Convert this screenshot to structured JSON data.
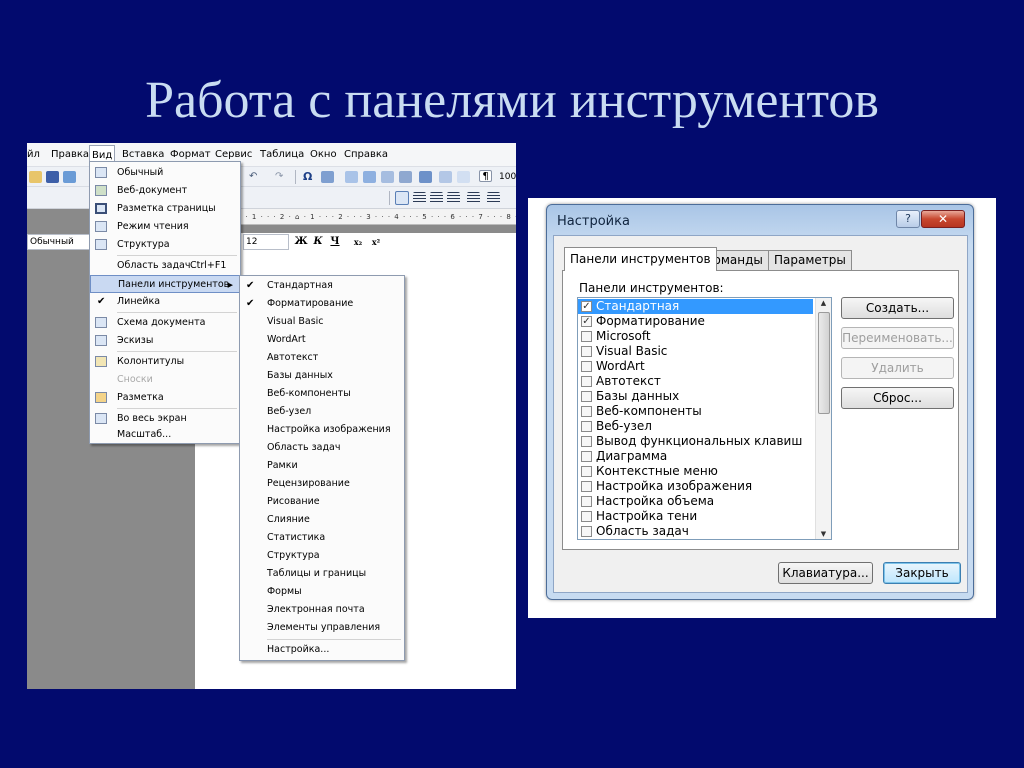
{
  "slide": {
    "title": "Работа с панелями инструментов"
  },
  "word": {
    "menubar": [
      "йл",
      "Правка",
      "Вид",
      "Вставка",
      "Формат",
      "Сервис",
      "Таблица",
      "Окно",
      "Справка"
    ],
    "zoom": "100",
    "style_value": "Обычный",
    "size_value": "12",
    "ruler_text": "· · 1 · · · 2 · ⌂ · 1 · · · 2 · · · 3 · · · 4 · · · 5 · · · 6 · · · 7 · · · 8 · · · 9 · · · 10 · · · 11 ·",
    "format_buttons": [
      "Ж",
      "К",
      "Ч",
      "x₂",
      "x²"
    ],
    "view_menu": [
      {
        "label": "Обычный",
        "icon": "normal-view-icon"
      },
      {
        "label": "Веб-документ",
        "icon": "web-view-icon"
      },
      {
        "label": "Разметка страницы",
        "icon": "page-layout-icon"
      },
      {
        "label": "Режим чтения",
        "icon": "reading-mode-icon"
      },
      {
        "label": "Структура",
        "icon": "outline-icon"
      },
      {
        "label": "Область задач",
        "shortcut": "Ctrl+F1"
      },
      {
        "label": "Панели инструментов",
        "submenu": true
      },
      {
        "label": "Линейка",
        "checked": true
      },
      {
        "label": "Схема документа",
        "icon": "document-map-icon"
      },
      {
        "label": "Эскизы",
        "icon": "thumbnails-icon"
      },
      {
        "label": "Колонтитулы",
        "icon": "header-footer-icon"
      },
      {
        "label": "Сноски",
        "disabled": true
      },
      {
        "label": "Разметка",
        "icon": "markup-icon"
      },
      {
        "label": "Во весь экран",
        "icon": "full-screen-icon"
      },
      {
        "label": "Масштаб..."
      }
    ],
    "toolbars_submenu": [
      {
        "label": "Стандартная",
        "checked": true
      },
      {
        "label": "Форматирование",
        "checked": true
      },
      {
        "label": "Visual Basic"
      },
      {
        "label": "WordArt"
      },
      {
        "label": "Автотекст"
      },
      {
        "label": "Базы данных"
      },
      {
        "label": "Веб-компоненты"
      },
      {
        "label": "Веб-узел"
      },
      {
        "label": "Настройка изображения"
      },
      {
        "label": "Область задач"
      },
      {
        "label": "Рамки"
      },
      {
        "label": "Рецензирование"
      },
      {
        "label": "Рисование"
      },
      {
        "label": "Слияние"
      },
      {
        "label": "Статистика"
      },
      {
        "label": "Структура"
      },
      {
        "label": "Таблицы и границы"
      },
      {
        "label": "Формы"
      },
      {
        "label": "Электронная почта"
      },
      {
        "label": "Элементы управления"
      },
      {
        "label": "Настройка..."
      }
    ]
  },
  "dialog": {
    "title": "Настройка",
    "help_label": "?",
    "close_label": "✕",
    "tabs": [
      "Панели инструментов",
      "Команды",
      "Параметры"
    ],
    "list_label": "Панели инструментов:",
    "toolbars": [
      {
        "label": "Стандартная",
        "checked": true,
        "selected": true
      },
      {
        "label": "Форматирование",
        "checked": true
      },
      {
        "label": "Microsoft"
      },
      {
        "label": "Visual Basic"
      },
      {
        "label": "WordArt"
      },
      {
        "label": "Автотекст"
      },
      {
        "label": "Базы данных"
      },
      {
        "label": "Веб-компоненты"
      },
      {
        "label": "Веб-узел"
      },
      {
        "label": "Вывод функциональных клавиш"
      },
      {
        "label": "Диаграмма"
      },
      {
        "label": "Контекстные меню"
      },
      {
        "label": "Настройка изображения"
      },
      {
        "label": "Настройка объема"
      },
      {
        "label": "Настройка тени"
      },
      {
        "label": "Область задач"
      }
    ],
    "buttons": {
      "create": "Создать...",
      "rename": "Переименовать...",
      "delete": "Удалить",
      "reset": "Сброс...",
      "keyboard": "Клавиатура...",
      "close": "Закрыть"
    }
  },
  "colors": {
    "slide_background": "#020a6e",
    "title_text": "#c9dcf2",
    "selection": "#3399ff"
  }
}
